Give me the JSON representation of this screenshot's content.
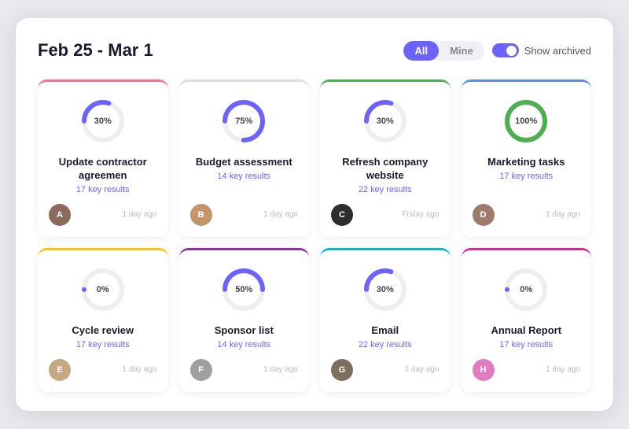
{
  "header": {
    "title": "Feb 25 - Mar 1",
    "filter_all": "All",
    "filter_mine": "Mine",
    "archive_label": "Show archived"
  },
  "cards": [
    {
      "id": "card-1",
      "title": "Update contractor agreemen",
      "key_results": "17 key results",
      "time": "1 day ago",
      "progress": 30,
      "border": "pink",
      "donut_color": "#6c63ff",
      "avatar_color": "#8b6a5e",
      "avatar_initial": "A"
    },
    {
      "id": "card-2",
      "title": "Budget assessment",
      "key_results": "14 key results",
      "time": "1 day ago",
      "progress": 75,
      "border": "gray",
      "donut_color": "#6c63ff",
      "avatar_color": "#c4956a",
      "avatar_initial": "B"
    },
    {
      "id": "card-3",
      "title": "Refresh company website",
      "key_results": "22 key results",
      "time": "Friday ago",
      "progress": 30,
      "border": "green",
      "donut_color": "#6c63ff",
      "avatar_color": "#2d2d2d",
      "avatar_initial": "C"
    },
    {
      "id": "card-4",
      "title": "Marketing tasks",
      "key_results": "17 key results",
      "time": "1 day ago",
      "progress": 100,
      "border": "blue",
      "donut_color": "#4caf50",
      "avatar_color": "#9e7b6a",
      "avatar_initial": "D"
    },
    {
      "id": "card-5",
      "title": "Cycle review",
      "key_results": "17 key results",
      "time": "1 day ago",
      "progress": 0,
      "border": "yellow",
      "donut_color": "#6c63ff",
      "avatar_color": "#c4a882",
      "avatar_initial": "E"
    },
    {
      "id": "card-6",
      "title": "Sponsor list",
      "key_results": "14 key results",
      "time": "1 day ago",
      "progress": 50,
      "border": "purple",
      "donut_color": "#6c63ff",
      "avatar_color": "#a0a0a0",
      "avatar_initial": "F"
    },
    {
      "id": "card-7",
      "title": "Email",
      "key_results": "22 key results",
      "time": "1 day ago",
      "progress": 30,
      "border": "cyan",
      "donut_color": "#6c63ff",
      "avatar_color": "#7d6e5e",
      "avatar_initial": "G"
    },
    {
      "id": "card-8",
      "title": "Annual Report",
      "key_results": "17 key results",
      "time": "1 day ago",
      "progress": 0,
      "border": "magenta",
      "donut_color": "#6c63ff",
      "avatar_color": "#e07bbf",
      "avatar_initial": "H"
    }
  ]
}
